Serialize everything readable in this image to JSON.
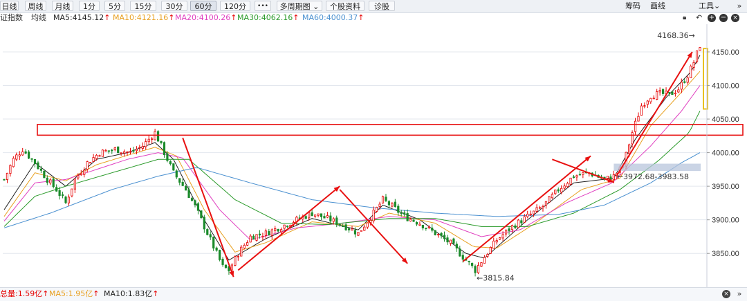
{
  "toolbar": {
    "periods": [
      "日线",
      "周线",
      "月线",
      "1分",
      "5分",
      "15分",
      "30分",
      "60分",
      "120分"
    ],
    "active_period": "60分",
    "more": "•••",
    "multi_period": "多周期图",
    "stock_info": "个股资料",
    "diagnose": "诊股",
    "chips": "筹码",
    "drawing": "画线",
    "tools": "工具"
  },
  "legend": {
    "index_name": "证指数",
    "ma_label": "均线",
    "ma5": "MA5:4145.12",
    "ma10": "MA10:4121.16",
    "ma20": "MA20:4100.26",
    "ma30": "MA30:4062.16",
    "ma60": "MA60:4000.37",
    "up_arrow": "↑"
  },
  "colors": {
    "up": "#e60000",
    "down": "#1a8a2a",
    "ma5": "#222222",
    "ma10": "#e8a020",
    "ma20": "#e040c0",
    "ma30": "#2a9a2a",
    "ma60": "#4a90d0",
    "annotation": "#e81010"
  },
  "chart_data": {
    "type": "candlestick",
    "y_ticks": [
      "4150.00",
      "4100.00",
      "4050.00",
      "4000.00",
      "3950.00",
      "3900.00",
      "3850.00"
    ],
    "ylim": [
      3808,
      4185
    ],
    "annotations": {
      "high": "4168.36",
      "low": "3815.84",
      "zone": "3972.68-3983.58"
    },
    "close_path": [
      [
        0,
        3960
      ],
      [
        6,
        3990
      ],
      [
        12,
        4005
      ],
      [
        20,
        3985
      ],
      [
        28,
        3960
      ],
      [
        34,
        3945
      ],
      [
        40,
        3925
      ],
      [
        46,
        3960
      ],
      [
        54,
        3985
      ],
      [
        62,
        4000
      ],
      [
        72,
        4005
      ],
      [
        82,
        4000
      ],
      [
        90,
        4010
      ],
      [
        98,
        4030
      ],
      [
        104,
        4000
      ],
      [
        110,
        3970
      ],
      [
        118,
        3945
      ],
      [
        124,
        3920
      ],
      [
        130,
        3890
      ],
      [
        136,
        3860
      ],
      [
        142,
        3830
      ],
      [
        146,
        3825
      ],
      [
        152,
        3850
      ],
      [
        160,
        3875
      ],
      [
        170,
        3880
      ],
      [
        180,
        3890
      ],
      [
        190,
        3900
      ],
      [
        200,
        3910
      ],
      [
        212,
        3900
      ],
      [
        222,
        3890
      ],
      [
        230,
        3880
      ],
      [
        240,
        3910
      ],
      [
        246,
        3930
      ],
      [
        252,
        3920
      ],
      [
        260,
        3905
      ],
      [
        270,
        3895
      ],
      [
        280,
        3880
      ],
      [
        290,
        3865
      ],
      [
        298,
        3845
      ],
      [
        306,
        3825
      ],
      [
        312,
        3845
      ],
      [
        320,
        3870
      ],
      [
        330,
        3890
      ],
      [
        340,
        3905
      ],
      [
        350,
        3920
      ],
      [
        360,
        3945
      ],
      [
        370,
        3965
      ],
      [
        380,
        3970
      ],
      [
        390,
        3960
      ],
      [
        396,
        3965
      ],
      [
        402,
        3980
      ],
      [
        408,
        4030
      ],
      [
        414,
        4070
      ],
      [
        420,
        4085
      ],
      [
        426,
        4088
      ],
      [
        432,
        4086
      ],
      [
        438,
        4095
      ],
      [
        444,
        4115
      ],
      [
        448,
        4135
      ],
      [
        452,
        4160
      ]
    ],
    "ma_series": {
      "ma5": [
        [
          0,
          3915
        ],
        [
          20,
          3985
        ],
        [
          40,
          3950
        ],
        [
          60,
          3990
        ],
        [
          80,
          4000
        ],
        [
          98,
          4015
        ],
        [
          110,
          3990
        ],
        [
          130,
          3900
        ],
        [
          146,
          3840
        ],
        [
          170,
          3872
        ],
        [
          200,
          3902
        ],
        [
          230,
          3885
        ],
        [
          246,
          3922
        ],
        [
          270,
          3900
        ],
        [
          300,
          3850
        ],
        [
          312,
          3843
        ],
        [
          340,
          3900
        ],
        [
          370,
          3955
        ],
        [
          396,
          3962
        ],
        [
          410,
          4020
        ],
        [
          430,
          4082
        ],
        [
          446,
          4120
        ],
        [
          452,
          4145
        ]
      ],
      "ma10": [
        [
          0,
          3905
        ],
        [
          20,
          3970
        ],
        [
          40,
          3958
        ],
        [
          60,
          3982
        ],
        [
          80,
          3996
        ],
        [
          98,
          4008
        ],
        [
          112,
          3995
        ],
        [
          130,
          3915
        ],
        [
          150,
          3852
        ],
        [
          170,
          3866
        ],
        [
          200,
          3897
        ],
        [
          230,
          3890
        ],
        [
          250,
          3910
        ],
        [
          280,
          3895
        ],
        [
          305,
          3860
        ],
        [
          320,
          3858
        ],
        [
          345,
          3895
        ],
        [
          375,
          3945
        ],
        [
          400,
          3962
        ],
        [
          420,
          4040
        ],
        [
          440,
          4090
        ],
        [
          452,
          4121
        ]
      ],
      "ma20": [
        [
          0,
          3898
        ],
        [
          20,
          3955
        ],
        [
          40,
          3960
        ],
        [
          60,
          3975
        ],
        [
          80,
          3990
        ],
        [
          100,
          4000
        ],
        [
          116,
          3992
        ],
        [
          140,
          3915
        ],
        [
          160,
          3870
        ],
        [
          190,
          3888
        ],
        [
          220,
          3895
        ],
        [
          250,
          3905
        ],
        [
          280,
          3900
        ],
        [
          310,
          3875
        ],
        [
          335,
          3885
        ],
        [
          365,
          3925
        ],
        [
          395,
          3955
        ],
        [
          420,
          4010
        ],
        [
          440,
          4062
        ],
        [
          452,
          4100
        ]
      ],
      "ma30": [
        [
          0,
          3890
        ],
        [
          20,
          3935
        ],
        [
          40,
          3950
        ],
        [
          70,
          3970
        ],
        [
          100,
          3990
        ],
        [
          120,
          3990
        ],
        [
          150,
          3930
        ],
        [
          180,
          3895
        ],
        [
          210,
          3893
        ],
        [
          250,
          3902
        ],
        [
          280,
          3902
        ],
        [
          310,
          3890
        ],
        [
          340,
          3890
        ],
        [
          370,
          3910
        ],
        [
          400,
          3945
        ],
        [
          425,
          3988
        ],
        [
          445,
          4030
        ],
        [
          452,
          4062
        ]
      ],
      "ma60": [
        [
          0,
          3888
        ],
        [
          30,
          3910
        ],
        [
          70,
          3945
        ],
        [
          100,
          3965
        ],
        [
          125,
          3978
        ],
        [
          160,
          3955
        ],
        [
          200,
          3930
        ],
        [
          240,
          3918
        ],
        [
          280,
          3910
        ],
        [
          320,
          3905
        ],
        [
          360,
          3908
        ],
        [
          390,
          3922
        ],
        [
          420,
          3955
        ],
        [
          440,
          3985
        ],
        [
          452,
          4000
        ]
      ]
    }
  },
  "bottom": {
    "volume": "总量:1.59亿",
    "ma5": "MA5:1.95亿",
    "ma10": "MA10:1.83亿",
    "up_arrow": "↑"
  }
}
